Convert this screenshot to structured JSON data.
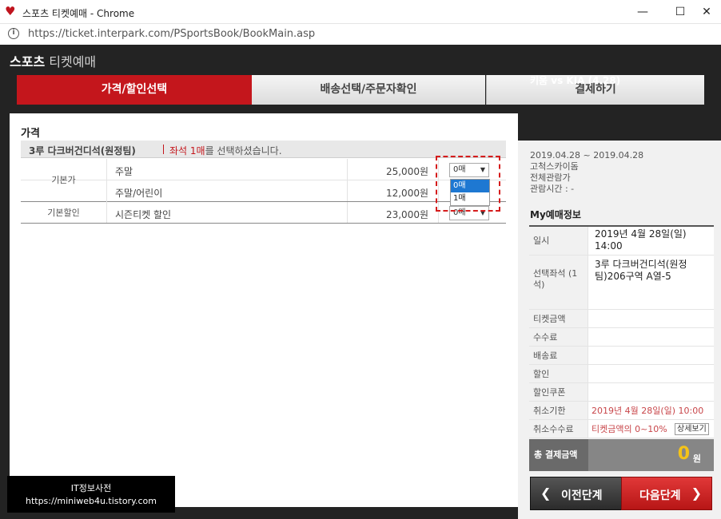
{
  "window": {
    "title": "스포츠 티켓예매 - Chrome",
    "url": "https://ticket.interpark.com/PSportsBook/BookMain.asp",
    "minimize": "—",
    "maximize": "☐",
    "close": "✕"
  },
  "page": {
    "title_bold": "스포츠",
    "title_rest": " 티켓예매"
  },
  "steps": [
    "가격/할인선택",
    "배송선택/주문자확인",
    "결제하기"
  ],
  "price_section": {
    "title": "가격",
    "seat_name": "3루 다크버건디석(원정팀)",
    "msg_red": "좌석 1매",
    "msg_rest": "를 선택하셨습니다.",
    "rows": [
      {
        "category": "기본가",
        "name": "주말",
        "price": "25,000원",
        "qty": "0매"
      },
      {
        "category": "",
        "name": "주말/어린이",
        "price": "12,000원",
        "qty": "0매"
      },
      {
        "category": "기본할인",
        "name": "시즌티켓 할인",
        "price": "23,000원",
        "qty": "0매"
      }
    ],
    "dropdown_options": [
      "0매",
      "1매"
    ],
    "dropdown_selected": "0매"
  },
  "right_panel": {
    "match": "키움 vs KIA (4.28)",
    "dates": "2019.04.28 ~ 2019.04.28",
    "venue": "고척스카이돔",
    "rating": "전체관람가",
    "duration": "관람시간 : -",
    "my_title": "My예매정보",
    "info_rows": [
      {
        "label": "일시",
        "value": "2019년 4월 28일(일) 14:00"
      },
      {
        "label": "선택좌석 (1석)",
        "value": "3루 다크버건디석(원정팀)206구역 A열-5"
      },
      {
        "label": "티켓금액",
        "value": ""
      },
      {
        "label": "수수료",
        "value": ""
      },
      {
        "label": "배송료",
        "value": ""
      },
      {
        "label": "할인",
        "value": ""
      },
      {
        "label": "할인쿠폰",
        "value": ""
      },
      {
        "label": "취소기한",
        "value": "2019년 4월 28일(일) 10:00"
      },
      {
        "label": "취소수수료",
        "value": "티켓금액의 0~10%"
      }
    ],
    "detail_button": "상세보기",
    "total_label": "총 결제금액",
    "total_value": "0",
    "total_unit": "원"
  },
  "buttons": {
    "prev": "이전단계",
    "next": "다음단계"
  },
  "watermark": {
    "line1": "IT정보사전",
    "line2": "https://miniweb4u.tistory.com"
  },
  "colors": {
    "accent_red": "#c4161c",
    "dark_bg": "#232323",
    "total_yellow": "#f5c318"
  }
}
